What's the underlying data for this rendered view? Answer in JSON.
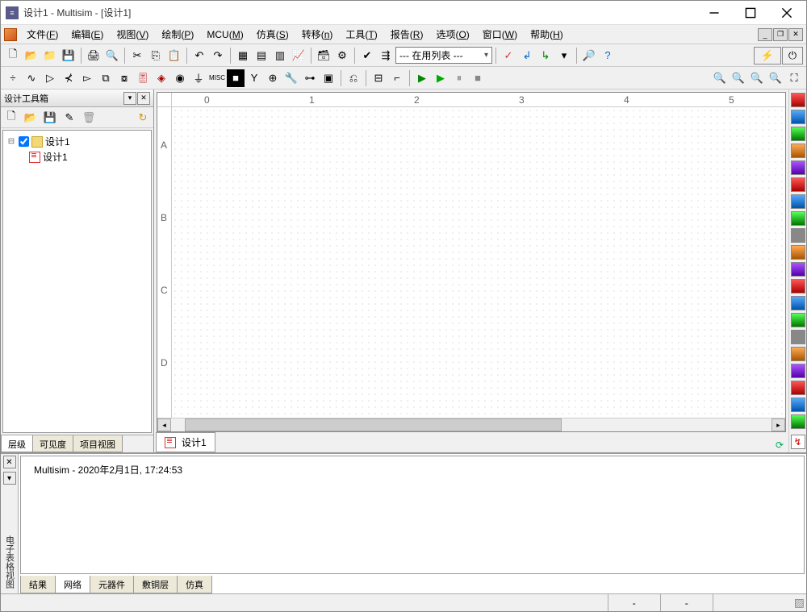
{
  "window": {
    "title": "设计1 - Multisim - [设计1]"
  },
  "menu": {
    "items": [
      {
        "label": "文件",
        "key": "F"
      },
      {
        "label": "编辑",
        "key": "E"
      },
      {
        "label": "视图",
        "key": "V"
      },
      {
        "label": "绘制",
        "key": "P"
      },
      {
        "label": "MCU",
        "key": "M"
      },
      {
        "label": "仿真",
        "key": "S"
      },
      {
        "label": "转移",
        "key": "n"
      },
      {
        "label": "工具",
        "key": "T"
      },
      {
        "label": "报告",
        "key": "R"
      },
      {
        "label": "选项",
        "key": "O"
      },
      {
        "label": "窗口",
        "key": "W"
      },
      {
        "label": "帮助",
        "key": "H"
      }
    ]
  },
  "toolbar": {
    "combo_value": "--- 在用列表 ---"
  },
  "toolbox": {
    "title": "设计工具箱",
    "tree": {
      "root": "设计1",
      "child": "设计1"
    },
    "tabs": [
      "层级",
      "可见度",
      "项目视图"
    ],
    "active_tab": 0
  },
  "canvas": {
    "ruler_h": [
      "0",
      "1",
      "2",
      "3",
      "4",
      "5"
    ],
    "ruler_v": [
      "A",
      "B",
      "C",
      "D"
    ],
    "doc_tab": "设计1"
  },
  "spreadsheet": {
    "side_label": "电子表格视图",
    "log_line": "Multisim  -  2020年2月1日, 17:24:53",
    "tabs": [
      "结果",
      "网络",
      "元器件",
      "敷铜层",
      "仿真"
    ],
    "active_tab": 1
  },
  "status": {
    "cell1": "-",
    "cell2": "-"
  }
}
